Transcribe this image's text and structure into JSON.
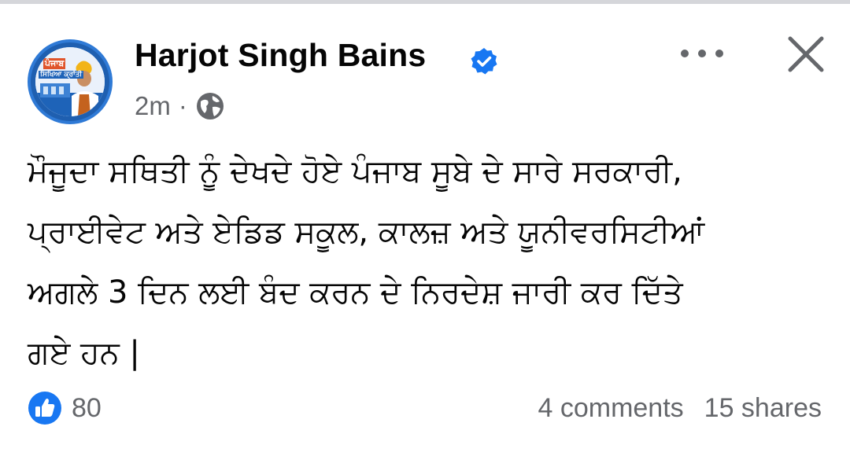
{
  "post": {
    "author": "Harjot Singh Bains",
    "time": "2m",
    "separator": "·",
    "avatar_text_top": "ਪੰਜਾਬ",
    "avatar_text_bottom": "ਸਿਖਿਆ ਕ੍ਰਾਂਤੀ",
    "text_lines": [
      "ਮੌਜੂਦਾ ਸਥਿਤੀ ਨੂੰ ਦੇਖਦੇ ਹੋਏ ਪੰਜਾਬ ਸੂਬੇ ਦੇ ਸਾਰੇ ਸਰਕਾਰੀ,",
      "ਪ੍ਰਾਈਵੇਟ ਅਤੇ ਏਡਿਡ ਸਕੂਲ, ਕਾਲਜ਼ ਅਤੇ ਯੂਨੀਵਰਸਿਟੀਆਂ",
      "ਅਗਲੇ 3 ਦਿਨ ਲਈ ਬੰਦ ਕਰਨ ਦੇ ਨਿਰਦੇਸ਼ ਜਾਰੀ ਕਰ ਦਿੱਤੇ",
      "ਗਏ ਹਨ |"
    ],
    "like_count": "80",
    "comments": "4 comments",
    "shares": "15 shares"
  },
  "icons": {
    "verified": "verified-badge-icon",
    "audience": "globe-icon",
    "more": "more-options-icon",
    "close": "close-icon",
    "like": "like-reaction-icon"
  },
  "colors": {
    "accent": "#1877f2",
    "secondary_text": "#65676b",
    "primary_text": "#050505"
  }
}
